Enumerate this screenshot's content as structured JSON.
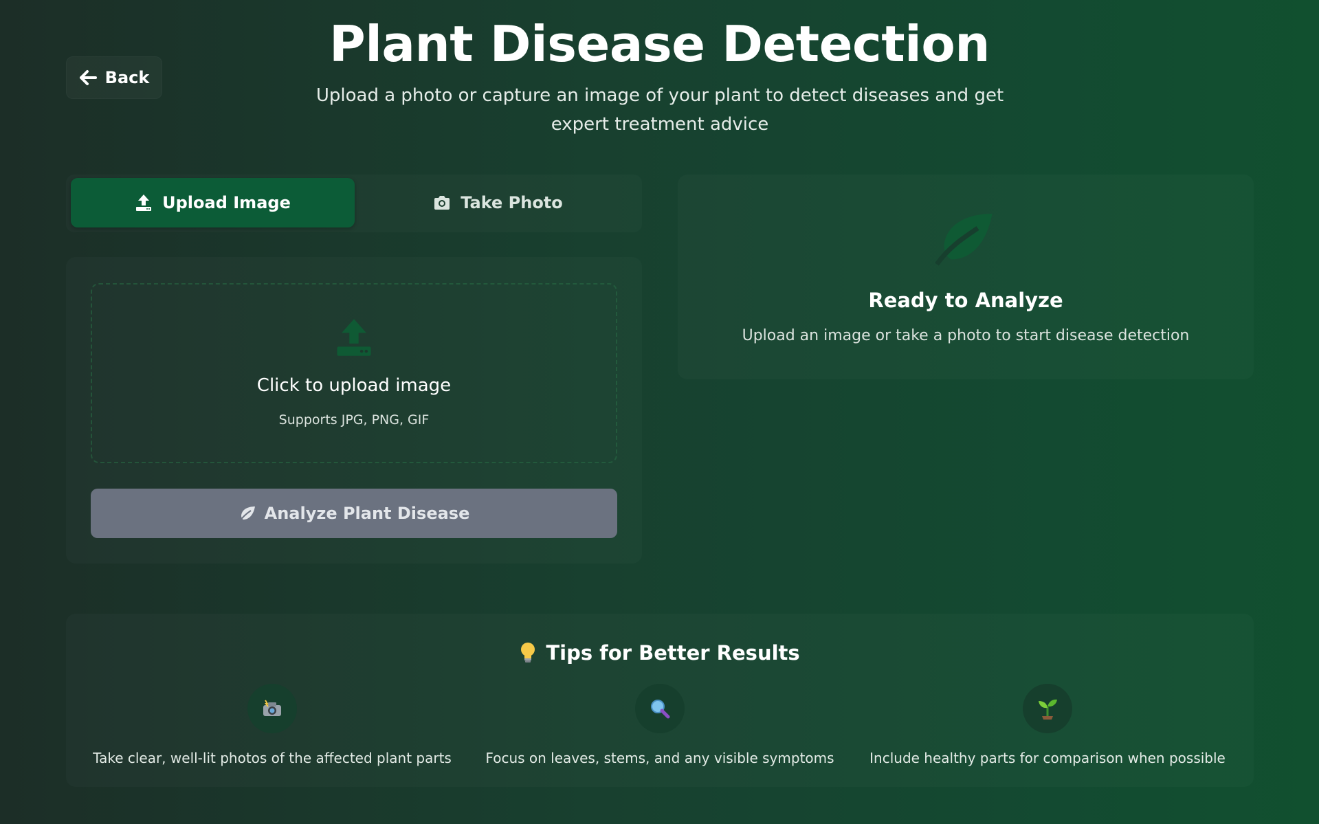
{
  "header": {
    "back_label": "Back",
    "title": "Plant Disease Detection",
    "subtitle": "Upload a photo or capture an image of your plant to detect diseases and get expert treatment advice"
  },
  "tabs": [
    {
      "label": "Upload Image",
      "icon": "upload-icon",
      "active": true
    },
    {
      "label": "Take Photo",
      "icon": "camera-icon",
      "active": false
    }
  ],
  "upload": {
    "title": "Click to upload image",
    "subtitle": "Supports JPG, PNG, GIF",
    "icon": "upload-icon"
  },
  "analyze_button": {
    "label": "Analyze Plant Disease",
    "icon": "leaf-icon",
    "disabled": true
  },
  "ready": {
    "title": "Ready to Analyze",
    "subtitle": "Upload an image or take a photo to start disease detection",
    "icon": "leaf-icon"
  },
  "tips": {
    "title": "Tips for Better Results",
    "icon": "lightbulb-icon",
    "items": [
      {
        "icon": "camera-flash-icon",
        "text": "Take clear, well-lit photos of the affected plant parts"
      },
      {
        "icon": "magnifier-icon",
        "text": "Focus on leaves, stems, and any visible symptoms"
      },
      {
        "icon": "seedling-icon",
        "text": "Include healthy parts for comparison when possible"
      }
    ]
  },
  "colors": {
    "accent": "#0c5c37",
    "disabled_button": "#6b7280",
    "icon_green": "#0f5a34"
  }
}
